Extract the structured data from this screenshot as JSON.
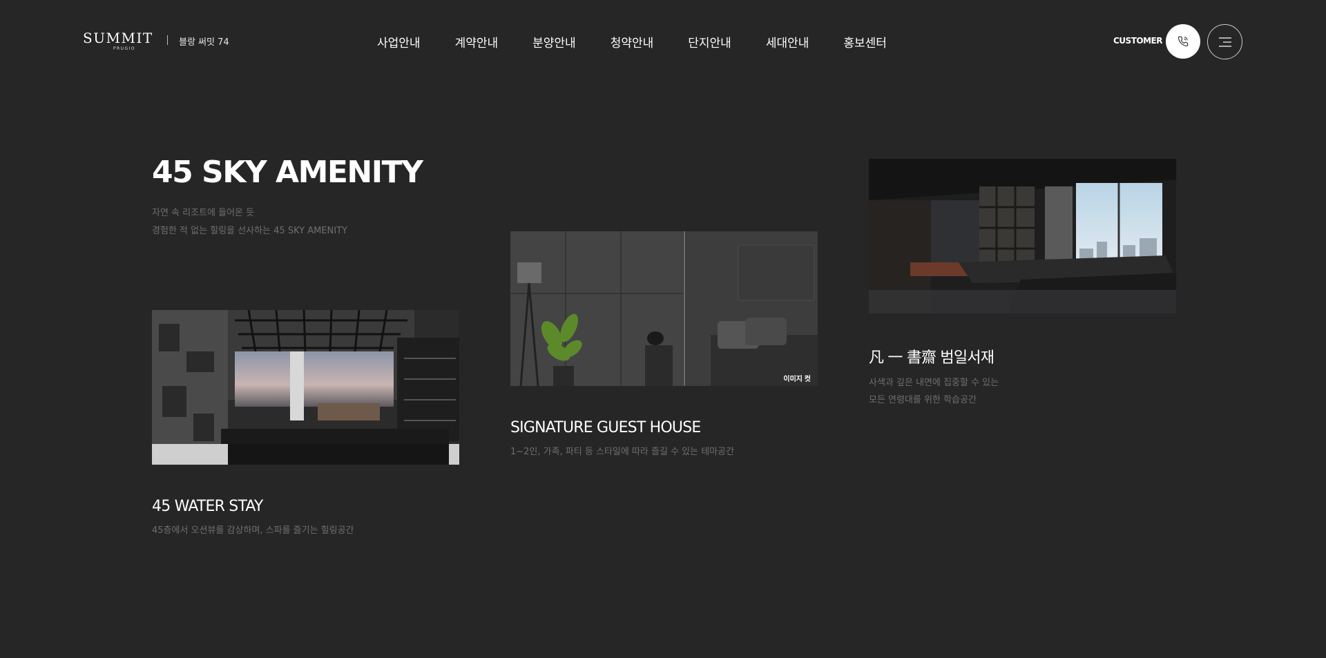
{
  "header": {
    "logo_main": "SUMMIT",
    "logo_sub": "PRUGIO",
    "site_name": "블랑 써밋 74",
    "nav": [
      "사업안내",
      "계약안내",
      "분양안내",
      "청약안내",
      "단지안내",
      "세대안내",
      "홍보센터"
    ],
    "customer_label": "CUSTOMER",
    "icons": {
      "phone": "phone-icon",
      "menu": "menu-icon"
    }
  },
  "section": {
    "title": "45 SKY AMENITY",
    "desc_line1": "자연 속 리조트에 들어온 듯",
    "desc_line2": "경험한 적 없는 힐링을 선사하는 45 SKY AMENITY"
  },
  "cards": [
    {
      "title": "45 WATER STAY",
      "desc_line1": "45층에서 오션뷰를 감상하며, 스파를 즐기는 힐링공간"
    },
    {
      "title": "SIGNATURE GUEST HOUSE",
      "desc_line1": "1~2인, 가족, 파티 등 스타일에 따라 즐길 수 있는 테마공간",
      "badge": "이미지 컷"
    },
    {
      "title": "凡 一 書齋 범일서재",
      "desc_line1": "사색과 깊은 내면에 집중할 수 있는",
      "desc_line2": "모든 연령대를 위한 학습공간"
    }
  ],
  "colors": {
    "background": "#262626",
    "text": "#ffffff",
    "muted": "#6f6f6f"
  }
}
